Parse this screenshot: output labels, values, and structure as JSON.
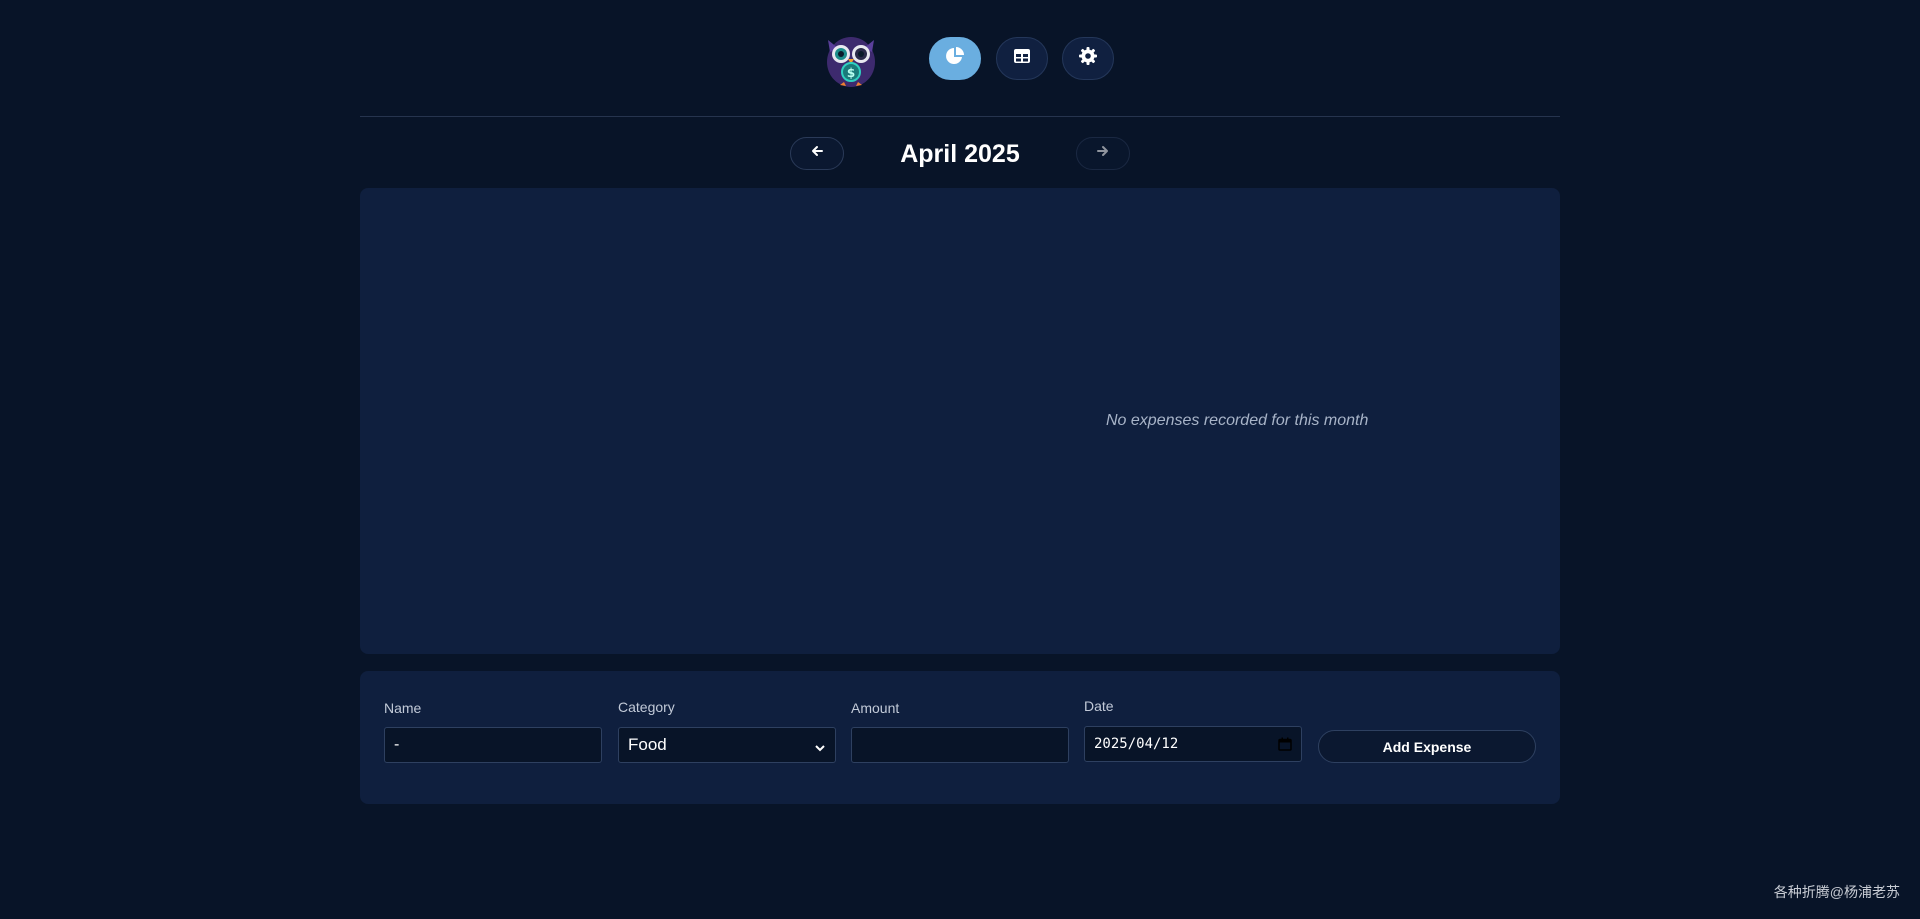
{
  "nav": {
    "logo_icon": "owl-dollar-logo",
    "items": [
      {
        "icon": "pie-chart-icon",
        "active": true
      },
      {
        "icon": "table-icon",
        "active": false
      },
      {
        "icon": "gear-icon",
        "active": false
      }
    ]
  },
  "month": {
    "title": "April 2025",
    "prev_icon": "arrow-left-icon",
    "next_icon": "arrow-right-icon"
  },
  "chart": {
    "empty_message": "No expenses recorded for this month"
  },
  "form": {
    "name_label": "Name",
    "name_value": "-",
    "category_label": "Category",
    "category_value": "Food",
    "amount_label": "Amount",
    "amount_value": "",
    "date_label": "Date",
    "date_value": "2025/04/12",
    "submit_label": "Add Expense"
  },
  "watermark": "各种折腾@杨浦老苏",
  "colors": {
    "background": "#081428",
    "card": "#0f1f3e",
    "accent": "#6aaee0"
  }
}
